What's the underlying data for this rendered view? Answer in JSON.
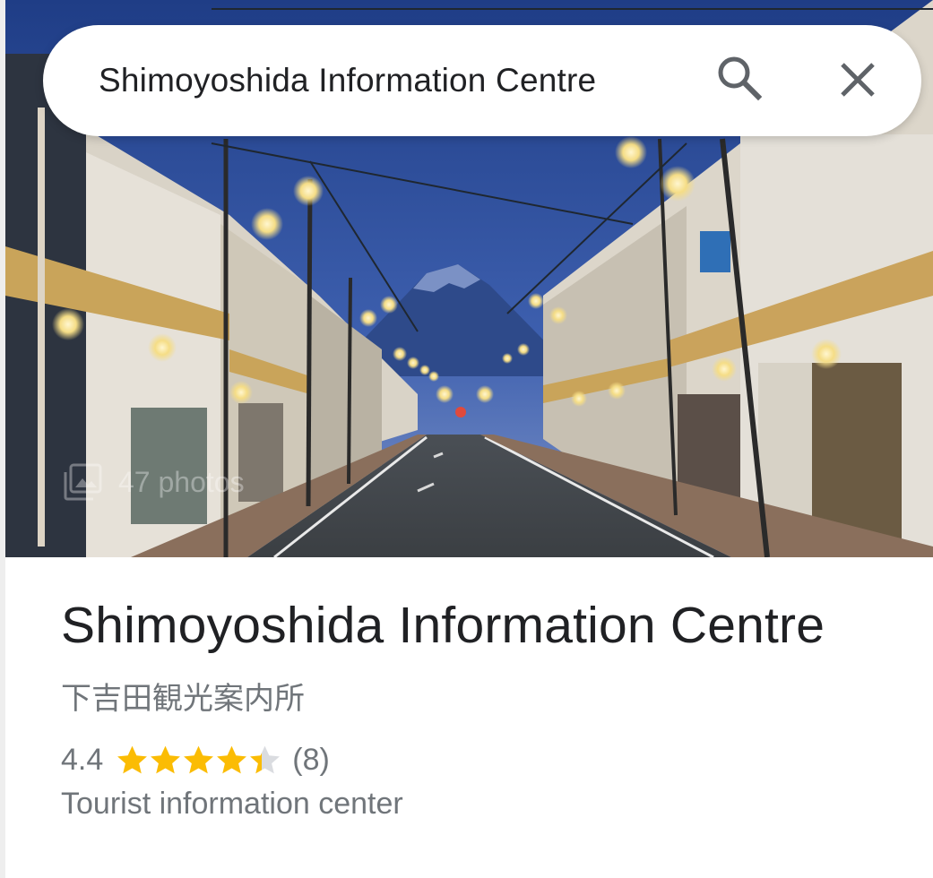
{
  "search": {
    "query": "Shimoyoshida Information Centre",
    "search_icon": "search-icon",
    "close_icon": "close-icon"
  },
  "photo": {
    "count_label": "47 photos",
    "icon": "photo-library-icon"
  },
  "place": {
    "name": "Shimoyoshida Information Centre",
    "native_name": "下吉田観光案内所",
    "rating": "4.4",
    "rating_value": 4.4,
    "rating_max": 5,
    "review_count": "(8)",
    "category": "Tourist information center"
  },
  "colors": {
    "star_filled": "#fbbc04",
    "star_empty": "#dadce0",
    "secondary_text": "#70757a",
    "primary_text": "#202124"
  }
}
